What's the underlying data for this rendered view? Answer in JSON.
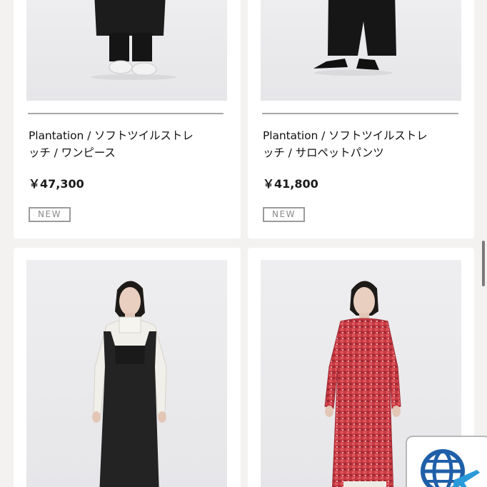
{
  "products": [
    {
      "title_line1": "Plantation / ソフトツイルストレ",
      "title_line2": "ッチ / ワンピース",
      "price": "￥47,300",
      "badge": "NEW"
    },
    {
      "title_line1": "Plantation / ソフトツイルストレ",
      "title_line2": "ッチ / サロペットパンツ",
      "price": "￥41,800",
      "badge": "NEW"
    }
  ],
  "lower_products": [
    {
      "photo": "black pinafore dress over white blouse"
    },
    {
      "photo": "red knit long dress"
    }
  ],
  "colors": {
    "background": "#f3f2f0",
    "card": "#ffffff",
    "photo_bg": "#e8e8ea",
    "red_knit": "#c83a42"
  }
}
